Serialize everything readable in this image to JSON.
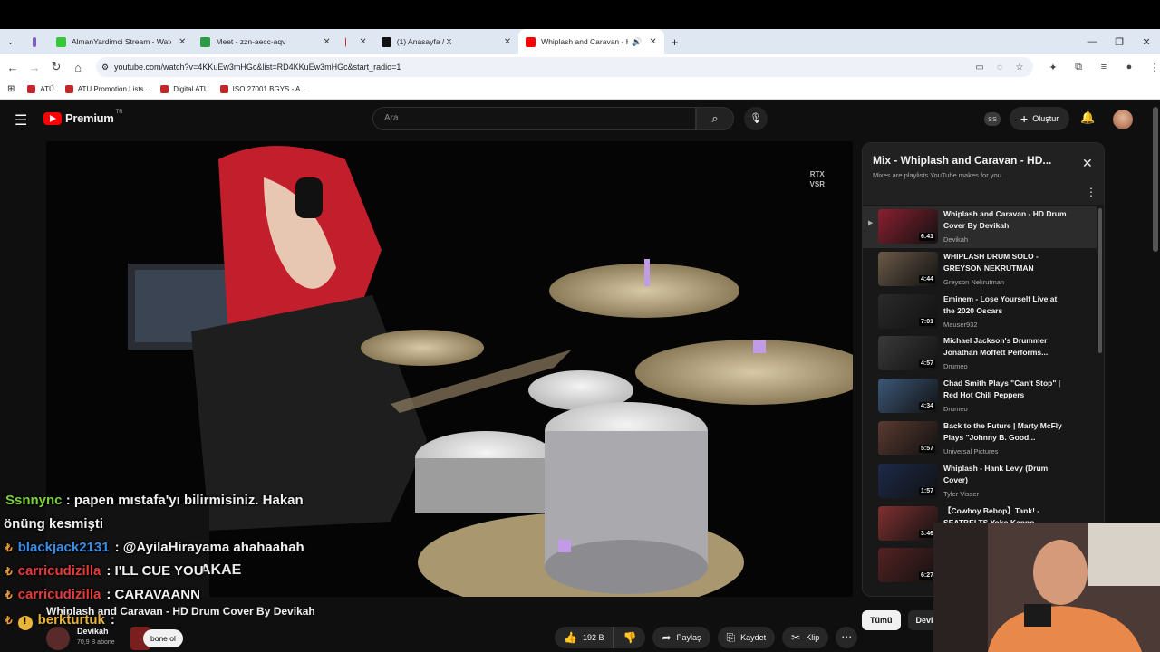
{
  "browser": {
    "tabs": [
      {
        "label": "",
        "fav": "#7c5cbf"
      },
      {
        "label": "AlmanYardimci Stream - Watch",
        "fav": "#37c837"
      },
      {
        "label": "Meet - zzn-aecc-aqv",
        "fav": "#2d9b46"
      },
      {
        "label": "",
        "fav": "#d12d2d"
      },
      {
        "label": "(1) Anasayfa / X",
        "fav": "#111111"
      },
      {
        "label": "Whiplash and Caravan - HD",
        "fav": "#ff0000"
      }
    ],
    "url": "youtube.com/watch?v=4KKuEw3mHGc&list=RD4KKuEw3mHGc&start_radio=1",
    "bookmarks": [
      "ATÜ",
      "ATU Promotion Lists...",
      "Digital ATU",
      "ISO 27001 BGYS - A..."
    ]
  },
  "youtube": {
    "logo_text": "Premium",
    "logo_region": "TR",
    "search_placeholder": "Ara",
    "ss_badge": "SS",
    "create_label": "Oluştur",
    "rtx_line1": "RTX",
    "rtx_line2": "VSR",
    "video_title": "Whiplash and Caravan - HD Drum Cover By Devikah",
    "channel": "Devikah",
    "subscribers": "70,9 B abone",
    "subscribe_label": "bone ol",
    "likes": "192 B",
    "share_label": "Paylaş",
    "save_label": "Kaydet",
    "clip_label": "Klip"
  },
  "playlist": {
    "title": "Mix - Whiplash and Caravan - HD...",
    "subtitle": "Mixes are playlists YouTube makes for you",
    "items": [
      {
        "title": "Whiplash and Caravan - HD Drum Cover By Devikah",
        "channel": "Devikah",
        "duration": "6:41",
        "current": true,
        "color": "#8a2030"
      },
      {
        "title": "WHIPLASH DRUM SOLO - GREYSON NEKRUTMAN",
        "channel": "Greyson Nekrutman",
        "duration": "4:44",
        "current": false,
        "color": "#6b5a48"
      },
      {
        "title": "Eminem - Lose Yourself Live at the 2020 Oscars",
        "channel": "Mauser932",
        "duration": "7:01",
        "current": false,
        "color": "#2a2a2a"
      },
      {
        "title": "Michael Jackson's Drummer Jonathan Moffett Performs...",
        "channel": "Drumeo",
        "duration": "4:57",
        "current": false,
        "color": "#3a3a3a"
      },
      {
        "title": "Chad Smith Plays \"Can't Stop\" | Red Hot Chili Peppers",
        "channel": "Drumeo",
        "duration": "4:34",
        "current": false,
        "color": "#3c5878"
      },
      {
        "title": "Back to the Future | Marty McFly Plays \"Johnny B. Good...",
        "channel": "Universal Pictures",
        "duration": "5:57",
        "current": false,
        "color": "#5a3a30"
      },
      {
        "title": "Whiplash - Hank Levy (Drum Cover)",
        "channel": "Tyler Visser",
        "duration": "1:57",
        "current": false,
        "color": "#1c2a4a"
      },
      {
        "title": "【Cowboy Bebop】Tank! - SEATBELTS Yoko Kanno...",
        "channel": "",
        "duration": "3:46",
        "current": false,
        "color": "#803030"
      },
      {
        "title": "",
        "channel": "",
        "duration": "6:27",
        "current": false,
        "color": "#552222"
      }
    ]
  },
  "chips": [
    "Tümü",
    "Devik"
  ],
  "chat": [
    {
      "user": "",
      "msg": "Ssnnync",
      "color": "#7ad23a",
      "text": ": papen mıstafa'yı bilirmisiniz. Hakan",
      "badge": ""
    },
    {
      "user": "",
      "msg": "",
      "color": "#ffffff",
      "text": "önüng kesmişti",
      "badge": ""
    },
    {
      "user": "blackjack2131",
      "msg": "",
      "color": "#3a8ee8",
      "text": ": @AyilaHirayama ahahaahah",
      "badge": "₺"
    },
    {
      "user": "carricudizilla",
      "msg": "",
      "color": "#e83a3a",
      "text": ": I'LL CUE YOU",
      "badge": "₺"
    },
    {
      "user": "carricudizilla",
      "msg": "",
      "color": "#e83a3a",
      "text": ": CARAVAANN",
      "badge": "₺"
    },
    {
      "user": "berkturtuk",
      "msg": "",
      "color": "#e8b43a",
      "text": ":",
      "badge": "!"
    }
  ]
}
